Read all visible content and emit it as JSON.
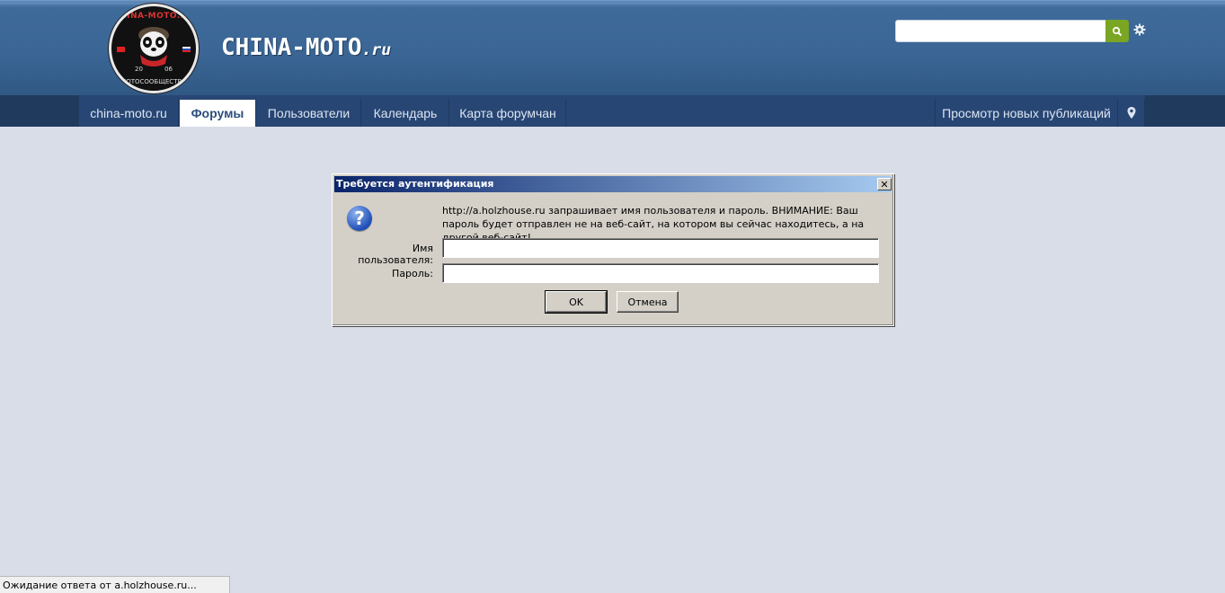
{
  "header": {
    "logo": {
      "ring_top": "CHINA-MOTO.RU",
      "ring_bottom": "МОТОСООБЩЕСТВО",
      "year_left": "20",
      "year_right": "06"
    },
    "site_title_main": "CHINA-MOTO",
    "site_title_tld": ".ru",
    "search": {
      "value": "",
      "icon": "search-icon",
      "accent": "#7aa623"
    },
    "settings_icon": "gear-icon"
  },
  "nav": {
    "items": [
      {
        "label": "china-moto.ru"
      },
      {
        "label": "Форумы",
        "active": true
      },
      {
        "label": "Пользователи"
      },
      {
        "label": "Календарь"
      },
      {
        "label": "Карта форумчан"
      }
    ],
    "right_link": "Просмотр новых публикаций",
    "map_pin_icon": "map-marker-icon"
  },
  "dialog": {
    "title": "Требуется аутентификация",
    "close_label": "✕",
    "icon": "question-icon",
    "message": "http://a.holzhouse.ru запрашивает имя пользователя и пароль. ВНИМАНИЕ: Ваш пароль будет отправлен не на веб-сайт, на котором вы сейчас находитесь, а на другой веб-сайт!",
    "username_label": "Имя пользователя:",
    "username_value": "",
    "password_label": "Пароль:",
    "password_value": "",
    "ok_label": "OK",
    "cancel_label": "Отмена"
  },
  "statusbar": {
    "text": "Ожидание ответа от a.holzhouse.ru..."
  }
}
